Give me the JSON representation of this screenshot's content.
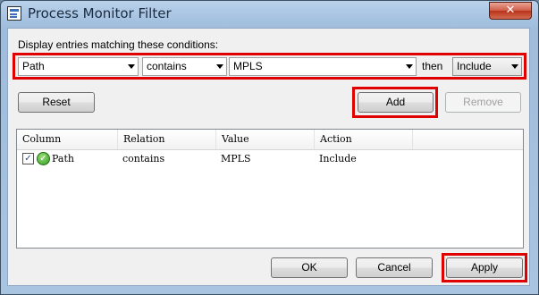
{
  "window": {
    "title": "Process Monitor Filter",
    "close_symbol": "✕"
  },
  "conditions_label": "Display entries matching these conditions:",
  "filter": {
    "column": "Path",
    "relation": "contains",
    "value": "MPLS",
    "then_label": "then",
    "action": "Include"
  },
  "buttons": {
    "reset": "Reset",
    "add": "Add",
    "remove": "Remove",
    "ok": "OK",
    "cancel": "Cancel",
    "apply": "Apply"
  },
  "table": {
    "headers": [
      "Column",
      "Relation",
      "Value",
      "Action"
    ],
    "rows": [
      {
        "checked": true,
        "checkmark": "✓",
        "column": "Path",
        "relation": "contains",
        "value": "MPLS",
        "action": "Include"
      }
    ]
  },
  "colors": {
    "highlight": "#e00000"
  }
}
